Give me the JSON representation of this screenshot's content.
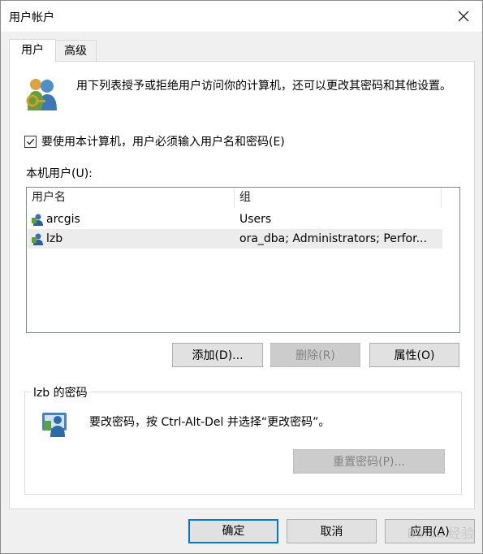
{
  "window": {
    "title": "用户帐户"
  },
  "tabs": [
    {
      "label": "用户"
    },
    {
      "label": "高级"
    }
  ],
  "intro": {
    "text": "用下列表授予或拒绝用户访问你的计算机，还可以更改其密码和其他设置。"
  },
  "require_password": {
    "label": "要使用本计算机，用户必须输入用户名和密码(E)",
    "checked": true
  },
  "users_section": {
    "label": "本机用户(U):"
  },
  "user_list": {
    "columns": [
      "用户名",
      "组"
    ],
    "rows": [
      {
        "name": "arcgis",
        "groups": "Users",
        "selected": false
      },
      {
        "name": "lzb",
        "groups": "ora_dba; Administrators; Perfor...",
        "selected": true
      }
    ]
  },
  "list_buttons": {
    "add": "添加(D)...",
    "remove": "删除(R)",
    "properties": "属性(O)"
  },
  "password_group": {
    "legend": "lzb 的密码",
    "text": "要改密码，按 Ctrl-Alt-Del 并选择“更改密码”。",
    "reset_button": "重置密码(P)..."
  },
  "dialog_buttons": {
    "ok": "确定",
    "cancel": "取消",
    "apply": "应用(A)"
  },
  "watermark": {
    "text": "Baidu 经验"
  },
  "colors": {
    "accent": "#0078d7",
    "selected_row": "#ececec",
    "disabled_button": "#cccccc"
  }
}
